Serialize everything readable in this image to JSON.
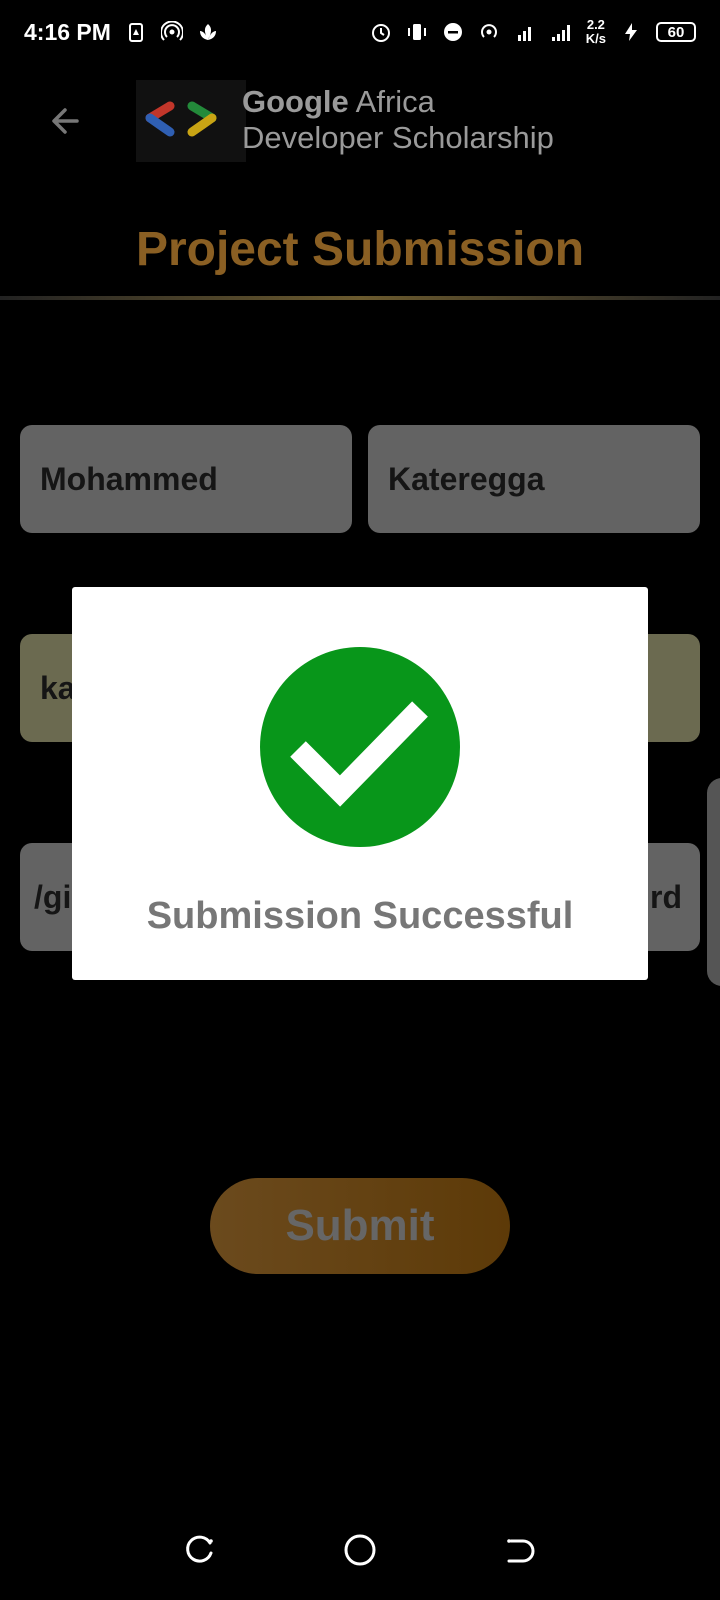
{
  "status_bar": {
    "time": "4:16 PM",
    "net_speed_value": "2.2",
    "net_speed_unit": "K/s",
    "battery_level": "60",
    "left_icons": [
      "sim-manager-icon",
      "hotspot-icon",
      "app-notification-icon"
    ],
    "right_icons": [
      "alarm-icon",
      "vibrate-icon",
      "do-not-disturb-icon",
      "hotspot-icon",
      "signal-h-plus-icon",
      "signal-bars-icon",
      "charging-icon",
      "battery-icon"
    ]
  },
  "header": {
    "back_icon": "arrow-left-icon",
    "logo_icon": "code-brackets-logo-icon",
    "brand_line1_bold": "Google",
    "brand_line1_rest": " Africa",
    "brand_line2": "Developer Scholarship"
  },
  "page": {
    "title": "Project Submission"
  },
  "form": {
    "first_name": "Mohammed",
    "last_name": "Kateregga",
    "email_partial": "ka",
    "link_partial_left": "/gi",
    "link_partial_right": "rd",
    "submit_label": "Submit"
  },
  "dialog": {
    "icon": "check-circle-icon",
    "message": "Submission Successful"
  },
  "colors": {
    "accent": "#8a5f23",
    "success": "#08961a",
    "background": "#000000"
  },
  "nav_bar": {
    "icons": [
      "recent-apps-icon",
      "home-icon",
      "back-nav-icon"
    ]
  }
}
